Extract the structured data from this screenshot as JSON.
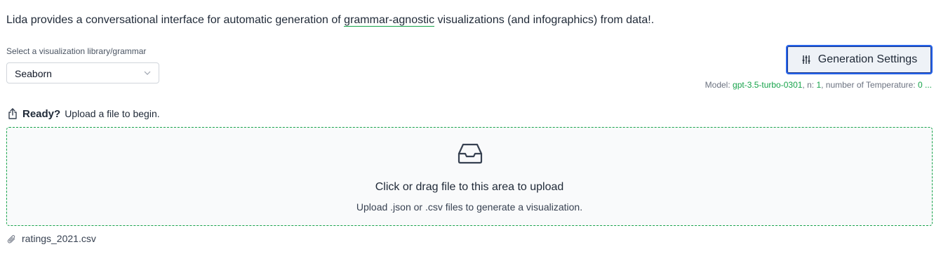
{
  "intro": {
    "before": "Lida provides a conversational interface for automatic generation of ",
    "link": "grammar-agnostic",
    "after": " visualizations (and infographics) from data!."
  },
  "library_select": {
    "label": "Select a visualization library/grammar",
    "value": "Seaborn"
  },
  "generation_settings": {
    "label": "Generation Settings"
  },
  "model_info": {
    "model_label": "Model: ",
    "model_value": "gpt-3.5-turbo-0301",
    "n_label": ", n: ",
    "n_value": "1",
    "temp_label": ", number of Temperature: ",
    "temp_value": "0 ..."
  },
  "status": {
    "ready": "Ready?",
    "message": "Upload a file to begin."
  },
  "dropzone": {
    "title": "Click or drag file to this area to upload",
    "hint": "Upload .json or .csv files to generate a visualization."
  },
  "files": [
    {
      "name": "ratings_2021.csv"
    }
  ],
  "colors": {
    "accent_green": "#16a34a",
    "button_border": "#2563eb"
  },
  "icons": [
    "chevron-down-icon",
    "sliders-icon",
    "upload-icon",
    "inbox-icon",
    "paperclip-icon"
  ]
}
